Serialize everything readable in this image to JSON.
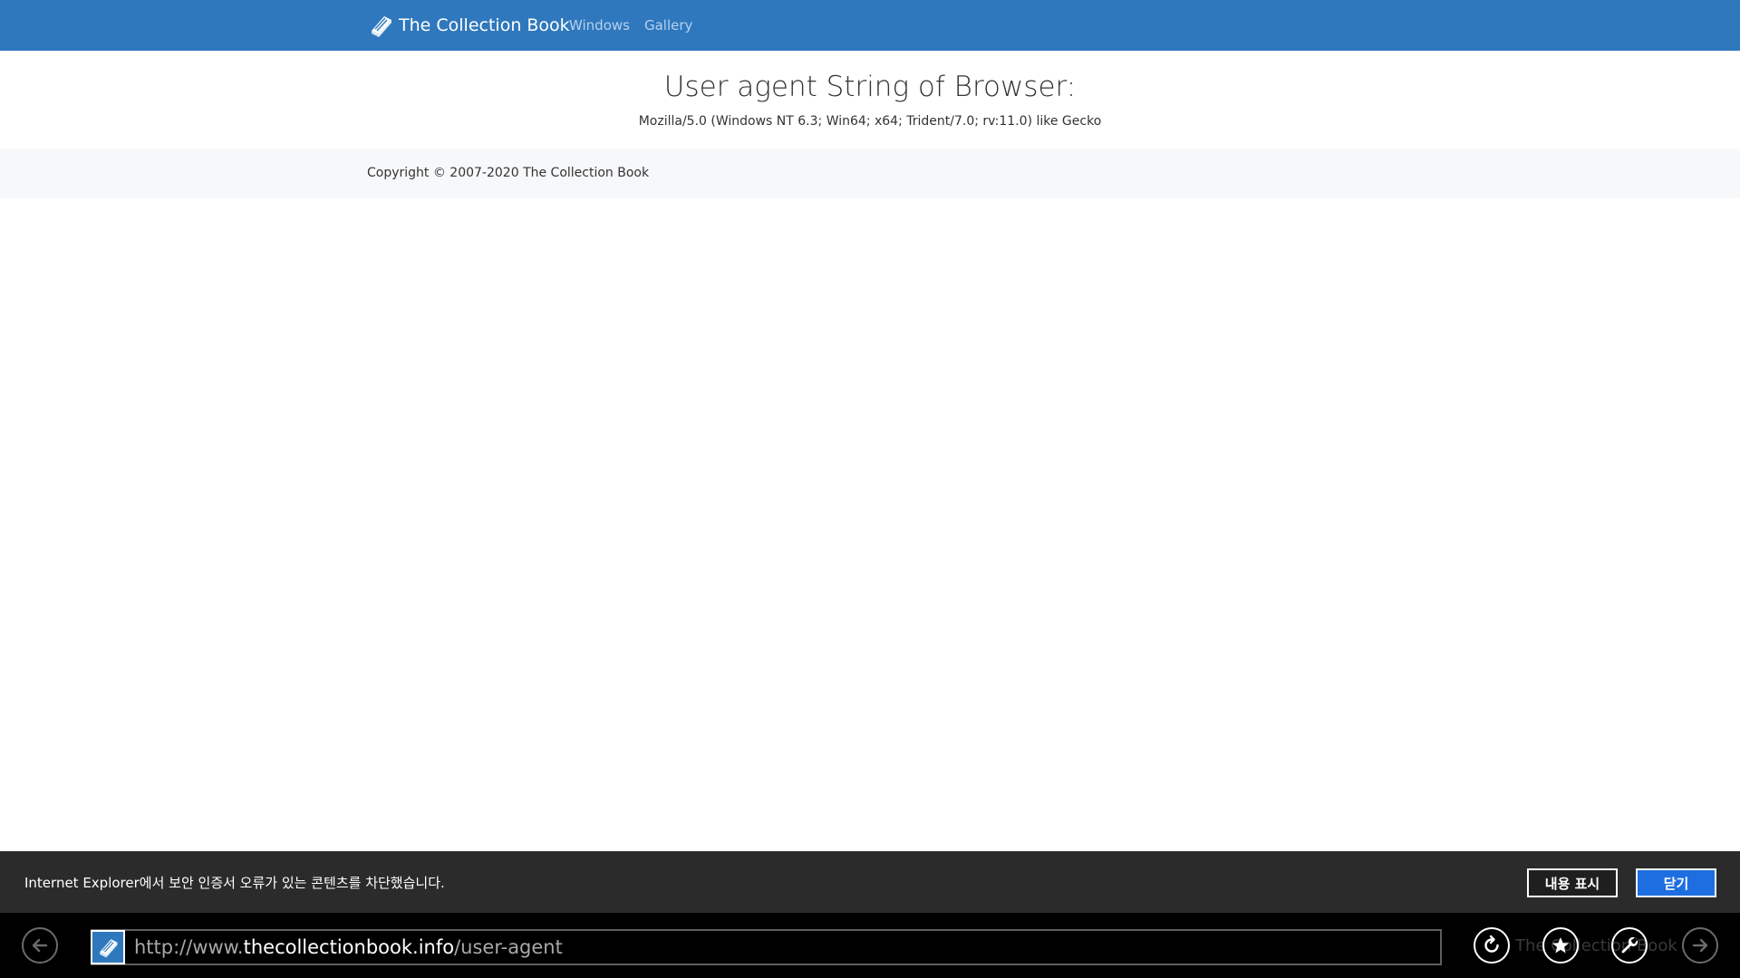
{
  "navbar": {
    "brand": "The Collection Book",
    "links": [
      "Windows",
      "Gallery"
    ],
    "background_color": "#2f78bd"
  },
  "hero": {
    "title": "User agent String of Browser:",
    "user_agent": "Mozilla/5.0 (Windows NT 6.3; Win64; x64; Trident/7.0; rv:11.0) like Gecko"
  },
  "footer": {
    "copyright": "Copyright © 2007-2020 The Collection Book"
  },
  "notification": {
    "message": "Internet Explorer에서 보안 인증서 오류가 있는 콘텐츠를 차단했습니다.",
    "show_content_label": "내용 표시",
    "close_label": "닫기"
  },
  "appbar": {
    "url_prefix": "http://www.",
    "url_domain": "thecollectionbook.info",
    "url_path": "/user-agent",
    "icons": [
      "back-arrow-icon",
      "site-book-icon",
      "refresh-icon",
      "favorites-star-icon",
      "tools-wrench-icon",
      "forward-arrow-icon"
    ],
    "watermark": "The Collection Book"
  }
}
